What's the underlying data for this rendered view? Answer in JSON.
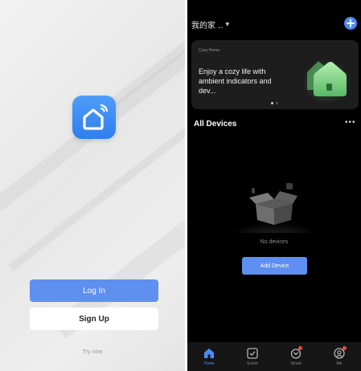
{
  "login": {
    "login_label": "Log In",
    "signup_label": "Sign Up",
    "try_now": "Try now"
  },
  "home": {
    "title": "我的家 ..",
    "banner": {
      "tag": "Cozy Home",
      "text": "Enjoy a cozy life with ambient indicators and dev...",
      "slides": 2,
      "active_slide": 1
    },
    "section_title": "All Devices",
    "empty_text": "No devices",
    "add_device_label": "Add Device"
  },
  "tabs": [
    {
      "label": "Home",
      "icon": "home-icon",
      "active": true,
      "badge": false
    },
    {
      "label": "Scene",
      "icon": "scene-icon",
      "active": false,
      "badge": false
    },
    {
      "label": "Smart",
      "icon": "smart-icon",
      "active": false,
      "badge": true
    },
    {
      "label": "Me",
      "icon": "profile-icon",
      "active": false,
      "badge": true
    }
  ],
  "colors": {
    "accent": "#5f8ff0",
    "badge": "#e94b3c",
    "dark_bg": "#000000",
    "card_bg": "#1d1d1d"
  }
}
